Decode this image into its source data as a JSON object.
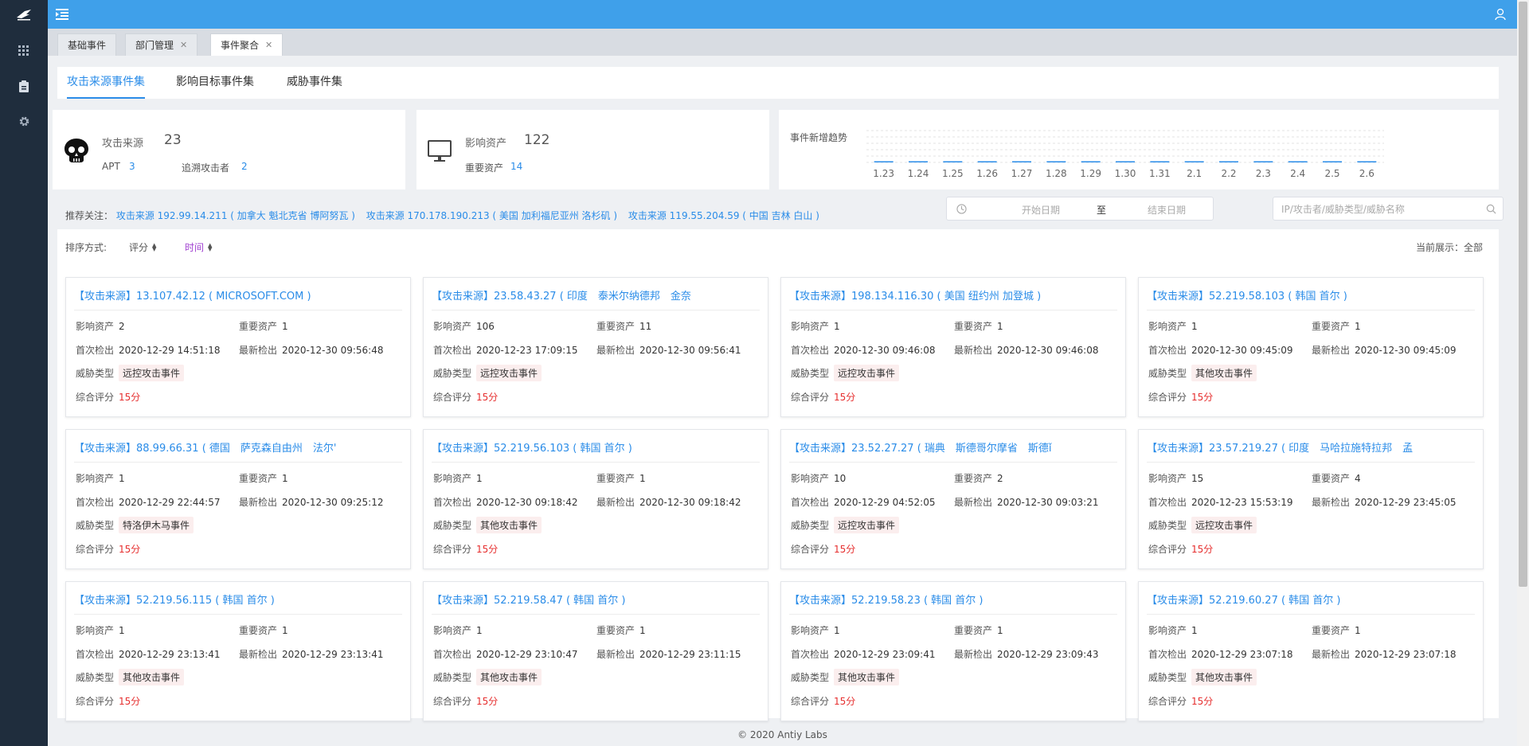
{
  "header": {
    "tabs": [
      {
        "label": "基础事件",
        "closable": false,
        "active": false
      },
      {
        "label": "部门管理",
        "closable": true,
        "active": false
      },
      {
        "label": "事件聚合",
        "closable": true,
        "active": true
      }
    ],
    "close_glyph": "✕"
  },
  "sidebar": {
    "icons": [
      "app-grid-icon",
      "clipboard-icon",
      "gear-icon"
    ]
  },
  "subtabs": [
    "攻击来源事件集",
    "影响目标事件集",
    "威胁事件集"
  ],
  "stats": {
    "attack_source": {
      "label": "攻击来源",
      "value": "23",
      "apt_label": "APT",
      "apt_value": "3",
      "trace_label": "追溯攻击者",
      "trace_value": "2"
    },
    "assets": {
      "label": "影响资产",
      "value": "122",
      "important_label": "重要资产",
      "important_value": "14"
    },
    "trend": {
      "label": "事件新增趋势"
    }
  },
  "chart_data": {
    "type": "bar",
    "categories": [
      "1.23",
      "1.24",
      "1.25",
      "1.26",
      "1.27",
      "1.28",
      "1.29",
      "1.30",
      "1.31",
      "2.1",
      "2.2",
      "2.3",
      "2.4",
      "2.5",
      "2.6"
    ],
    "values": [
      0,
      0,
      0,
      0,
      0,
      0,
      0,
      0,
      0,
      0,
      0,
      0,
      0,
      0,
      0
    ],
    "title": "事件新增趋势",
    "xlabel": "",
    "ylabel": "",
    "grid": true,
    "bar_color": "#2a8ce8"
  },
  "recommend": {
    "prefix": "推荐关注：",
    "items": [
      "攻击来源 192.99.14.211 ( 加拿大 魁北克省 博阿努瓦 )",
      "攻击来源 170.178.190.213 ( 美国 加利福尼亚州 洛杉矶 )",
      "攻击来源 119.55.204.59 ( 中国 吉林 白山 )"
    ]
  },
  "filters": {
    "start_placeholder": "开始日期",
    "to_label": "至",
    "end_placeholder": "结束日期",
    "search_placeholder": "IP/攻击者/威胁类型/威胁名称"
  },
  "sort": {
    "label": "排序方式:",
    "score": "评分",
    "time": "时间",
    "current_view": "当前展示：全部"
  },
  "labels": {
    "affected": "影响资产",
    "important": "重要资产",
    "first": "首次检出",
    "latest": "最新检出",
    "threat_type": "威胁类型",
    "score": "综合评分"
  },
  "events": [
    {
      "title": "【攻击来源】13.107.42.12 ( MICROSOFT.COM )",
      "affected": "2",
      "important": "1",
      "first": "2020-12-29 14:51:18",
      "latest": "2020-12-30 09:56:48",
      "type": "远控攻击事件",
      "score": "15分"
    },
    {
      "title": "【攻击来源】23.58.43.27 ( 印度　泰米尔纳德邦　金奈",
      "affected": "106",
      "important": "11",
      "first": "2020-12-23 17:09:15",
      "latest": "2020-12-30 09:56:41",
      "type": "远控攻击事件",
      "score": "15分"
    },
    {
      "title": "【攻击来源】198.134.116.30 ( 美国 纽约州 加登城 )",
      "affected": "1",
      "important": "1",
      "first": "2020-12-30 09:46:08",
      "latest": "2020-12-30 09:46:08",
      "type": "远控攻击事件",
      "score": "15分"
    },
    {
      "title": "【攻击来源】52.219.58.103 ( 韩国 首尔 )",
      "affected": "1",
      "important": "1",
      "first": "2020-12-30 09:45:09",
      "latest": "2020-12-30 09:45:09",
      "type": "其他攻击事件",
      "score": "15分"
    },
    {
      "title": "【攻击来源】88.99.66.31 ( 德国　萨克森自由州　法尔'",
      "affected": "1",
      "important": "1",
      "first": "2020-12-29 22:44:57",
      "latest": "2020-12-30 09:25:12",
      "type": "特洛伊木马事件",
      "score": "15分"
    },
    {
      "title": "【攻击来源】52.219.56.103 ( 韩国 首尔 )",
      "affected": "1",
      "important": "1",
      "first": "2020-12-30 09:18:42",
      "latest": "2020-12-30 09:18:42",
      "type": "其他攻击事件",
      "score": "15分"
    },
    {
      "title": "【攻击来源】23.52.27.27 ( 瑞典　斯德哥尔摩省　斯德ǐ",
      "affected": "10",
      "important": "2",
      "first": "2020-12-29 04:52:05",
      "latest": "2020-12-30 09:03:21",
      "type": "远控攻击事件",
      "score": "15分"
    },
    {
      "title": "【攻击来源】23.57.219.27 ( 印度　马哈拉施特拉邦　孟",
      "affected": "15",
      "important": "4",
      "first": "2020-12-23 15:53:19",
      "latest": "2020-12-29 23:45:05",
      "type": "远控攻击事件",
      "score": "15分"
    },
    {
      "title": "【攻击来源】52.219.56.115 ( 韩国 首尔 )",
      "affected": "1",
      "important": "1",
      "first": "2020-12-29 23:13:41",
      "latest": "2020-12-29 23:13:41",
      "type": "其他攻击事件",
      "score": "15分"
    },
    {
      "title": "【攻击来源】52.219.58.47 ( 韩国 首尔 )",
      "affected": "1",
      "important": "1",
      "first": "2020-12-29 23:10:47",
      "latest": "2020-12-29 23:11:15",
      "type": "其他攻击事件",
      "score": "15分"
    },
    {
      "title": "【攻击来源】52.219.58.23 ( 韩国 首尔 )",
      "affected": "1",
      "important": "1",
      "first": "2020-12-29 23:09:41",
      "latest": "2020-12-29 23:09:43",
      "type": "其他攻击事件",
      "score": "15分"
    },
    {
      "title": "【攻击来源】52.219.60.27 ( 韩国 首尔 )",
      "affected": "1",
      "important": "1",
      "first": "2020-12-29 23:07:18",
      "latest": "2020-12-29 23:07:18",
      "type": "其他攻击事件",
      "score": "15分"
    }
  ],
  "footer": "© 2020 Antiy Labs",
  "colors": {
    "topbar": "#3fa0ea",
    "sidebar": "#1f2d3d",
    "accent": "#2a8ce8",
    "score": "#e62e2e",
    "sort_active": "#a040d0"
  }
}
